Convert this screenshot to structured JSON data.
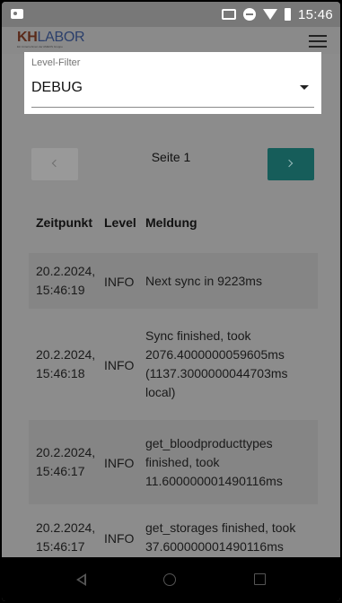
{
  "status_bar": {
    "time": "15:46"
  },
  "header": {
    "logo_kh": "KH",
    "logo_labor": "LABOR",
    "logo_sub": "Ein Unternehmen der AMEOS Gruppe"
  },
  "filter": {
    "label": "Level-Filter",
    "value": "DEBUG"
  },
  "pager": {
    "label": "Seite 1"
  },
  "table": {
    "headers": {
      "time": "Zeitpunkt",
      "level": "Level",
      "message": "Meldung"
    },
    "rows": [
      {
        "time": "20.2.2024, 15:46:19",
        "level": "INFO",
        "message": "Next sync in 9223ms"
      },
      {
        "time": "20.2.2024, 15:46:18",
        "level": "INFO",
        "message": "Sync finished, took 2076.4000000059605ms (1137.3000000044703ms local)"
      },
      {
        "time": "20.2.2024, 15:46:17",
        "level": "INFO",
        "message": "get_bloodproducttypes finished, took 11.600000001490116ms"
      },
      {
        "time": "20.2.2024, 15:46:17",
        "level": "INFO",
        "message": "get_storages finished, took 37.600000001490116ms"
      }
    ]
  }
}
